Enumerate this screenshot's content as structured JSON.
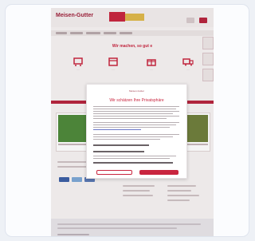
{
  "site": {
    "logo_text": "Meisen-Gutter"
  },
  "banner": {
    "title": "Wir machen, so gut e"
  },
  "consent": {
    "brand": "Meisen-Gutter",
    "heading": "Wir schätzen Ihre Privatsphäre"
  },
  "colors": {
    "brand_red": "#c9253f",
    "accent_gold": "#e0b94a",
    "link_blue": "#6b78c8"
  },
  "icons": [
    "cart-icon",
    "calendar-icon",
    "gift-icon",
    "truck-icon"
  ]
}
